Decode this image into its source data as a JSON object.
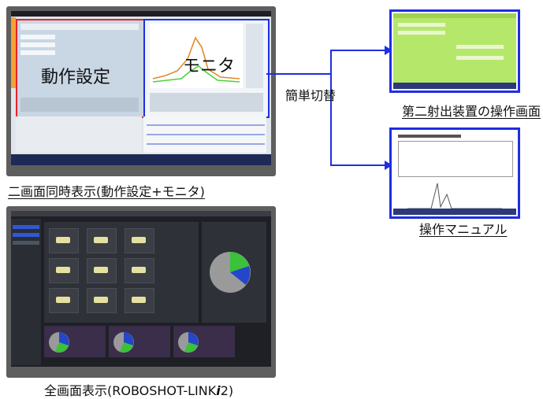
{
  "top_tablet": {
    "overlay_left": "動作設定",
    "overlay_right": "モニタ",
    "caption": "二画面同時表示(動作設定+モニタ)"
  },
  "switch_label": "簡単切替",
  "second_screen_caption": "第二射出装置の操作画面",
  "manual_caption": "操作マニュアル",
  "bottom_tablet": {
    "caption_prefix": "全画面表示(ROBOSHOT-LINK",
    "caption_italic": "i",
    "caption_suffix": "2)"
  },
  "colors": {
    "red_frame": "#e8232a",
    "blue_frame": "#1f2ee0",
    "green_screen": "#b5e86a",
    "chart_orange": "#e38a2a",
    "chart_green": "#4bd33a",
    "pie_gray": "#9a9a9a",
    "pie_green": "#39c23a",
    "pie_blue": "#2546c9"
  }
}
